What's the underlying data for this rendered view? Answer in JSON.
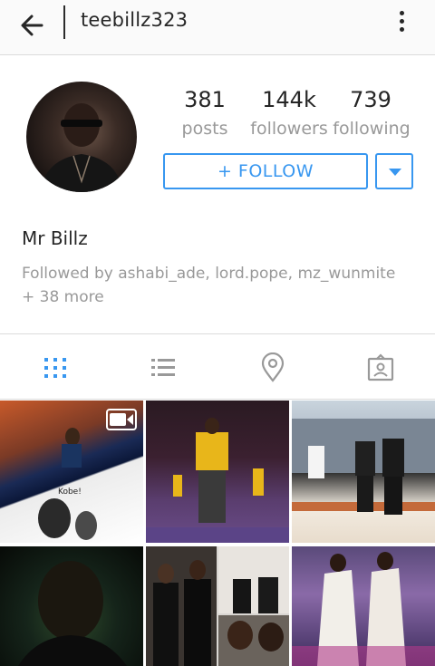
{
  "header": {
    "username": "teebillz323",
    "back_icon": "arrow-left-icon",
    "more_icon": "more-vertical-icon"
  },
  "profile": {
    "stats": {
      "posts": {
        "value": "381",
        "label": "posts"
      },
      "followers": {
        "value": "144k",
        "label": "followers"
      },
      "following": {
        "value": "739",
        "label": "following"
      }
    },
    "follow_label": "+ FOLLOW",
    "full_name": "Mr Billz",
    "followed_by": "Followed by ashabi_ade, lord.pope, mz_wunmite + 38 more"
  },
  "tabs": [
    {
      "icon": "grid-view-icon",
      "active": true
    },
    {
      "icon": "list-view-icon",
      "active": false
    },
    {
      "icon": "location-pin-icon",
      "active": false
    },
    {
      "icon": "tagged-photos-icon",
      "active": false
    }
  ],
  "grid": {
    "tile_1_overlay_text": "Kobe!",
    "tile_1_badge": "video-camera-icon"
  },
  "colors": {
    "accent": "#3897f0",
    "muted_text": "#999999",
    "divider": "#dbdbdb"
  }
}
